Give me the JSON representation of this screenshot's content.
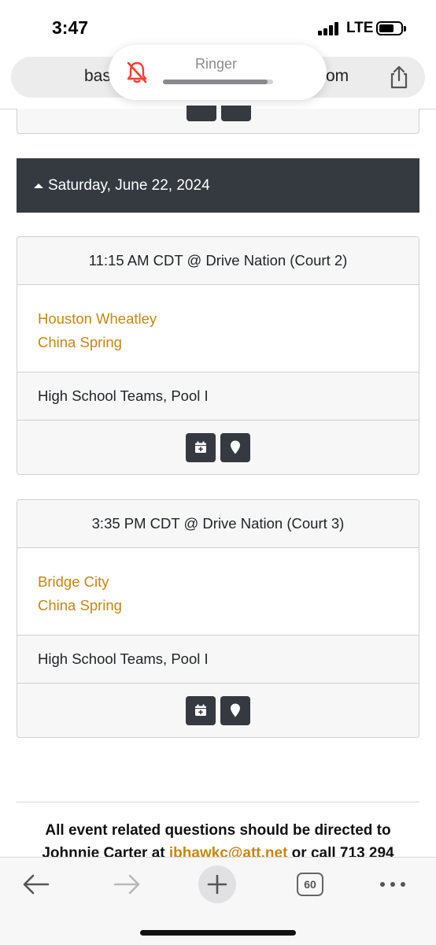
{
  "status_bar": {
    "time": "3:47",
    "network": "LTE"
  },
  "url_bar": {
    "prefix": "bas",
    "suffix": "om"
  },
  "ringer": {
    "label": "Ringer",
    "level": 0.95
  },
  "date_header": {
    "label": "Saturday, June 22, 2024"
  },
  "games": [
    {
      "header": "11:15 AM CDT @ Drive Nation (Court 2)",
      "team1": "Houston Wheatley",
      "team2": "China Spring",
      "pool": "High School Teams, Pool I"
    },
    {
      "header": "3:35 PM CDT @ Drive Nation (Court 3)",
      "team1": "Bridge City",
      "team2": "China Spring",
      "pool": "High School Teams, Pool I"
    }
  ],
  "footer": {
    "line1": "All event related questions should be directed to",
    "line2_start": "Johnnie Carter at ",
    "email": "jbhawkc@att.net",
    "line2_end": " or call 713 294"
  },
  "toolbar": {
    "tab_count": "60"
  },
  "colors": {
    "link": "#c8860d",
    "dark": "#343a40",
    "ringer_muted": "#ff3b30"
  }
}
